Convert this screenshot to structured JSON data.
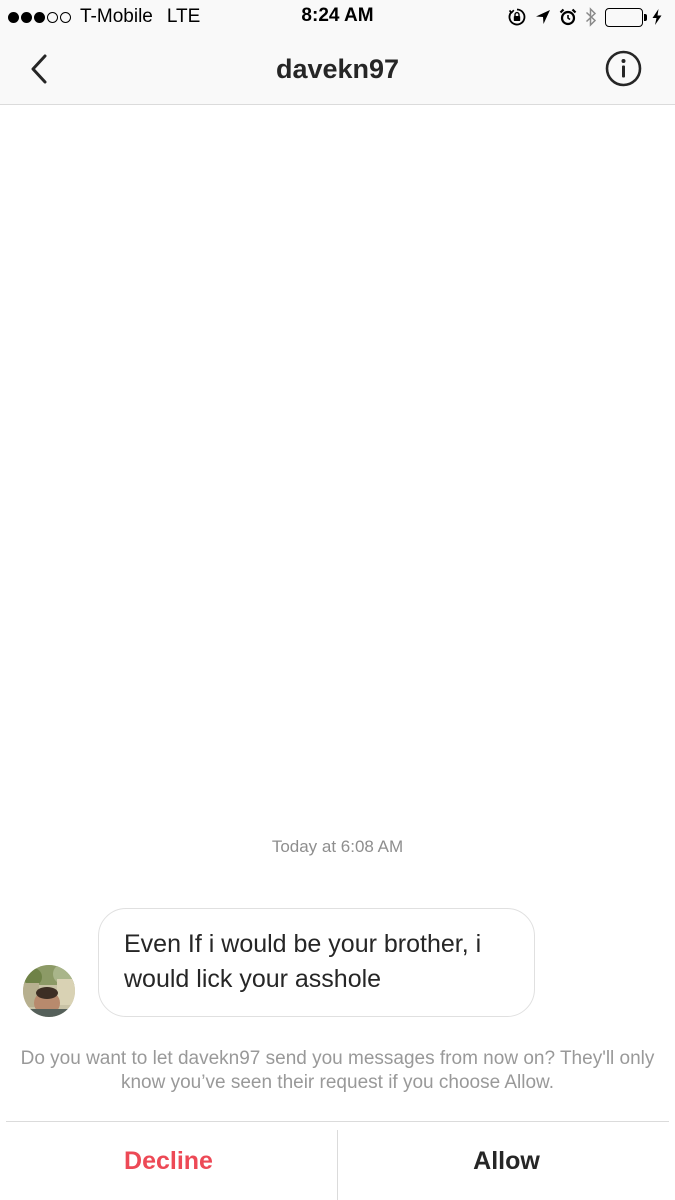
{
  "status_bar": {
    "signal_bars_filled": 3,
    "signal_bars_total": 5,
    "carrier": "T-Mobile",
    "network": "LTE",
    "time": "8:24 AM",
    "battery_level": 1.0,
    "icons": [
      "orientation-lock-icon",
      "location-arrow-icon",
      "alarm-icon",
      "bluetooth-icon",
      "battery-icon",
      "charging-bolt-icon"
    ]
  },
  "header": {
    "title": "davekn97",
    "back_icon": "chevron-left-icon",
    "info_icon": "info-circle-icon"
  },
  "conversation": {
    "timestamp": "Today at 6:08 AM",
    "messages": [
      {
        "sender": "davekn97",
        "text": "Even If i would be your brother, i would lick your asshole"
      }
    ]
  },
  "request": {
    "prompt": "Do you want to let davekn97 send you messages from now on? They'll only know you’ve seen their request if you choose Allow.",
    "decline_label": "Decline",
    "allow_label": "Allow"
  },
  "colors": {
    "decline": "#ed4956",
    "battery": "#4cd964",
    "header_bg": "#f9f9f9",
    "muted_text": "#8e8e8e"
  }
}
